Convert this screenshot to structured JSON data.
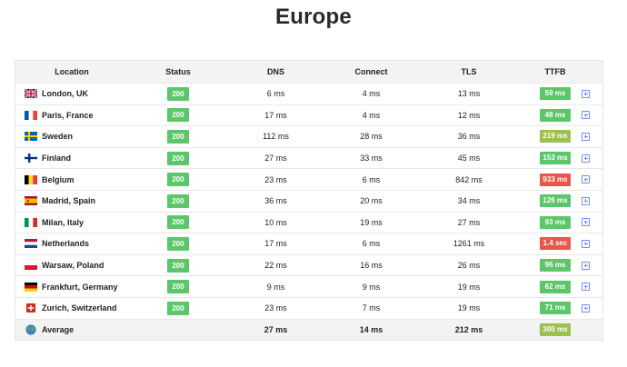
{
  "title": "Europe",
  "headers": {
    "location": "Location",
    "status": "Status",
    "dns": "DNS",
    "connect": "Connect",
    "tls": "TLS",
    "ttfb": "TTFB"
  },
  "colors": {
    "green": "#5cc66a",
    "olive": "#9bc04e",
    "red": "#e8574a",
    "expand": "#6f8ff0"
  },
  "rows": [
    {
      "flag": "uk-flag-icon",
      "location": "London, UK",
      "status": "200",
      "dns": "6 ms",
      "connect": "4 ms",
      "tls": "13 ms",
      "ttfb": "59 ms",
      "ttfb_color": "#5cc66a"
    },
    {
      "flag": "france-flag-icon",
      "location": "Paris, France",
      "status": "200",
      "dns": "17 ms",
      "connect": "4 ms",
      "tls": "12 ms",
      "ttfb": "48 ms",
      "ttfb_color": "#5cc66a"
    },
    {
      "flag": "sweden-flag-icon",
      "location": "Sweden",
      "status": "200",
      "dns": "112 ms",
      "connect": "28 ms",
      "tls": "36 ms",
      "ttfb": "219 ms",
      "ttfb_color": "#9bc04e"
    },
    {
      "flag": "finland-flag-icon",
      "location": "Finland",
      "status": "200",
      "dns": "27 ms",
      "connect": "33 ms",
      "tls": "45 ms",
      "ttfb": "153 ms",
      "ttfb_color": "#5cc66a"
    },
    {
      "flag": "belgium-flag-icon",
      "location": "Belgium",
      "status": "200",
      "dns": "23 ms",
      "connect": "6 ms",
      "tls": "842 ms",
      "ttfb": "933 ms",
      "ttfb_color": "#e8574a"
    },
    {
      "flag": "spain-flag-icon",
      "location": "Madrid, Spain",
      "status": "200",
      "dns": "36 ms",
      "connect": "20 ms",
      "tls": "34 ms",
      "ttfb": "126 ms",
      "ttfb_color": "#5cc66a"
    },
    {
      "flag": "italy-flag-icon",
      "location": "Milan, Italy",
      "status": "200",
      "dns": "10 ms",
      "connect": "19 ms",
      "tls": "27 ms",
      "ttfb": "93 ms",
      "ttfb_color": "#5cc66a"
    },
    {
      "flag": "netherlands-flag-icon",
      "location": "Netherlands",
      "status": "200",
      "dns": "17 ms",
      "connect": "6 ms",
      "tls": "1261 ms",
      "ttfb": "1.4 sec",
      "ttfb_color": "#e8574a"
    },
    {
      "flag": "poland-flag-icon",
      "location": "Warsaw, Poland",
      "status": "200",
      "dns": "22 ms",
      "connect": "16 ms",
      "tls": "26 ms",
      "ttfb": "96 ms",
      "ttfb_color": "#5cc66a"
    },
    {
      "flag": "germany-flag-icon",
      "location": "Frankfurt, Germany",
      "status": "200",
      "dns": "9 ms",
      "connect": "9 ms",
      "tls": "19 ms",
      "ttfb": "62 ms",
      "ttfb_color": "#5cc66a"
    },
    {
      "flag": "switzerland-flag-icon",
      "location": "Zurich, Switzerland",
      "status": "200",
      "dns": "23 ms",
      "connect": "7 ms",
      "tls": "19 ms",
      "ttfb": "71 ms",
      "ttfb_color": "#5cc66a"
    }
  ],
  "average": {
    "icon": "globe-icon",
    "label": "Average",
    "dns": "27 ms",
    "connect": "14 ms",
    "tls": "212 ms",
    "ttfb": "300 ms",
    "ttfb_color": "#9bc04e"
  }
}
